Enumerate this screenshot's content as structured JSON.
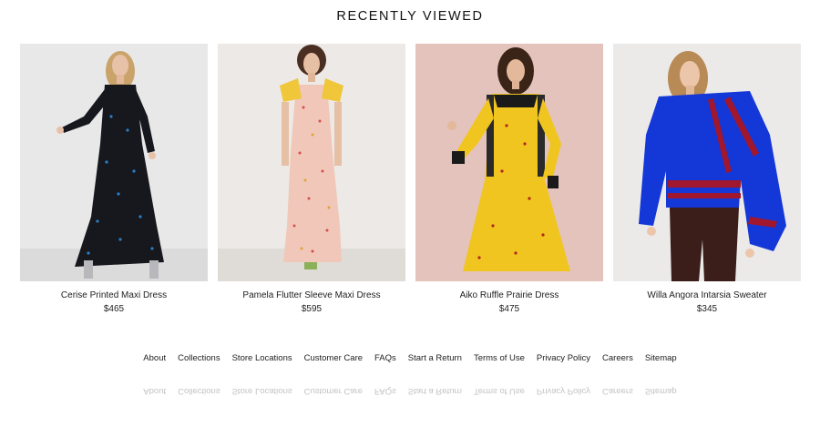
{
  "section": {
    "title": "RECENTLY VIEWED"
  },
  "products": [
    {
      "name": "Cerise Printed Maxi Dress",
      "price": "$465",
      "image": "woman-in-black-maxi-dress-photo"
    },
    {
      "name": "Pamela Flutter Sleeve Maxi Dress",
      "price": "$595",
      "image": "woman-in-pink-floral-maxi-dress-photo"
    },
    {
      "name": "Aiko Ruffle Prairie Dress",
      "price": "$475",
      "image": "woman-in-yellow-prairie-dress-photo"
    },
    {
      "name": "Willa Angora Intarsia Sweater",
      "price": "$345",
      "image": "woman-in-blue-red-sweater-photo"
    }
  ],
  "footer": {
    "links": [
      "About",
      "Collections",
      "Store Locations",
      "Customer Care",
      "FAQs",
      "Start a Return",
      "Terms of Use",
      "Privacy Policy",
      "Careers",
      "Sitemap"
    ]
  },
  "colors": {
    "background": "#ffffff",
    "text": "#1a1a1a"
  }
}
